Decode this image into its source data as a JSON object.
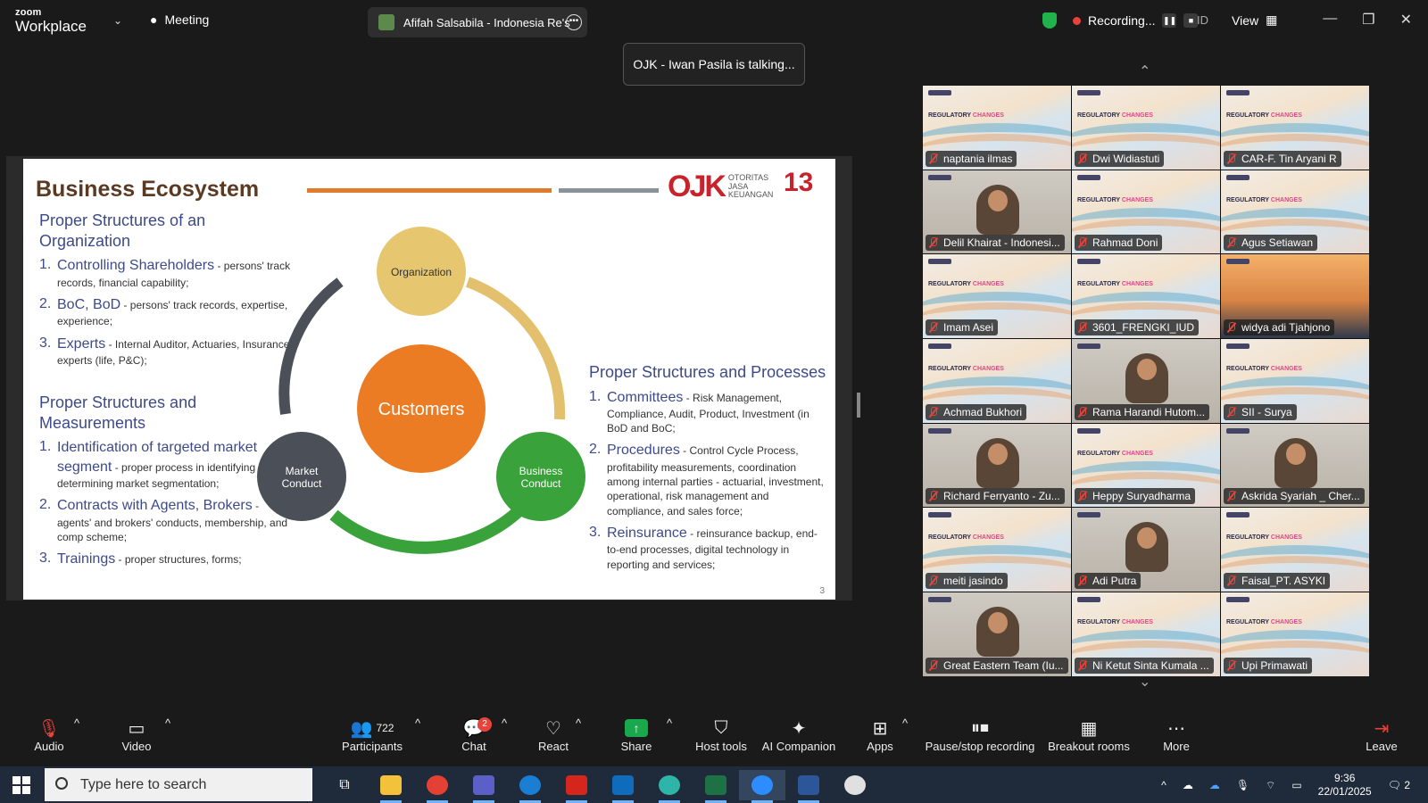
{
  "app": {
    "brand_small": "zoom",
    "brand_big": "Workplace",
    "meeting_label": "Meeting"
  },
  "speaker_pill": {
    "name": "Afifah Salsabila - Indonesia Re's"
  },
  "recording": {
    "label": "Recording...",
    "id_label": "ID",
    "view_label": "View"
  },
  "talking_banner": "OJK - Iwan Pasila is talking...",
  "slide": {
    "title": "Business Ecosystem",
    "logo_mark": "OJK",
    "logo_text_1": "OTORITAS",
    "logo_text_2": "JASA",
    "logo_text_3": "KEUANGAN",
    "anniversary": "13",
    "left_sections": [
      {
        "heading": "Proper Structures of an Organization",
        "items": [
          {
            "num": "1.",
            "lead": "Controlling Shareholders",
            "desc": " - persons' track records, financial capability;"
          },
          {
            "num": "2.",
            "lead": "BoC, BoD",
            "desc": " - persons' track records, expertise, experience;"
          },
          {
            "num": "3.",
            "lead": "Experts",
            "desc": " - Internal Auditor, Actuaries, Insurance experts (life, P&C);"
          }
        ]
      },
      {
        "heading": "Proper Structures and Measurements",
        "items": [
          {
            "num": "1.",
            "lead": "Identification of targeted market segment",
            "desc": " - proper process in identifying and determining market segmentation;"
          },
          {
            "num": "2.",
            "lead": "Contracts with Agents, Brokers",
            "desc": " - agents' and brokers' conducts, membership, and comp scheme;"
          },
          {
            "num": "3.",
            "lead": "Trainings",
            "desc": " - proper structures, forms;"
          }
        ]
      }
    ],
    "right_section": {
      "heading": "Proper Structures and Processes",
      "items": [
        {
          "num": "1.",
          "lead": "Committees",
          "desc": " - Risk Management, Compliance, Audit, Product, Investment (in BoD and BoC;"
        },
        {
          "num": "2.",
          "lead": "Procedures",
          "desc": " - Control Cycle Process, profitability measurements, coordination among internal parties - actuarial, investment, operational, risk management and compliance, and sales force;"
        },
        {
          "num": "3.",
          "lead": "Reinsurance",
          "desc": " - reinsurance backup, end-to-end processes, digital technology in reporting and services;"
        }
      ]
    },
    "diagram": {
      "center": "Customers",
      "top": "Organization",
      "left": "Market Conduct",
      "right": "Business Conduct"
    },
    "page_number": "3"
  },
  "gallery": [
    {
      "name": "naptania ilmas",
      "kind": "slide"
    },
    {
      "name": "Dwi Widiastuti",
      "kind": "slide"
    },
    {
      "name": "CAR-F. Tin Aryani R",
      "kind": "slide"
    },
    {
      "name": "Delil Khairat - Indonesi...",
      "kind": "cam"
    },
    {
      "name": "Rahmad Doni",
      "kind": "slide"
    },
    {
      "name": "Agus Setiawan",
      "kind": "slide"
    },
    {
      "name": "Imam Asei",
      "kind": "slide"
    },
    {
      "name": "3601_FRENGKI_IUD",
      "kind": "slide"
    },
    {
      "name": "widya adi Tjahjono",
      "kind": "bridge"
    },
    {
      "name": "Achmad Bukhori",
      "kind": "slide"
    },
    {
      "name": "Rama Harandi Hutom...",
      "kind": "cam"
    },
    {
      "name": "SII - Surya",
      "kind": "slide"
    },
    {
      "name": "Richard Ferryanto - Zu...",
      "kind": "cam"
    },
    {
      "name": "Heppy Suryadharma",
      "kind": "slide"
    },
    {
      "name": "Askrida Syariah _ Cher...",
      "kind": "cam"
    },
    {
      "name": "meiti jasindo",
      "kind": "slide"
    },
    {
      "name": "Adi Putra",
      "kind": "cam"
    },
    {
      "name": "Faisal_PT. ASYKI",
      "kind": "slide"
    },
    {
      "name": "Great Eastern Team (Iu...",
      "kind": "cam"
    },
    {
      "name": "Ni Ketut Sinta Kumala ...",
      "kind": "slide"
    },
    {
      "name": "Upi Primawati",
      "kind": "slide"
    }
  ],
  "gallery_slide_title_a": "REGULATORY ",
  "gallery_slide_title_b": "CHANGES",
  "toolbar": {
    "audio": "Audio",
    "video": "Video",
    "participants": "Participants",
    "participants_count": "722",
    "chat": "Chat",
    "chat_badge": "2",
    "react": "React",
    "share": "Share",
    "host_tools": "Host tools",
    "ai_companion": "AI Companion",
    "apps": "Apps",
    "pause_recording": "Pause/stop recording",
    "breakout_rooms": "Breakout rooms",
    "more": "More",
    "leave": "Leave"
  },
  "taskbar": {
    "search_placeholder": "Type here to search",
    "time": "9:36",
    "date": "22/01/2025",
    "notif_count": "2"
  },
  "colors": {
    "accent_green": "#19a84b",
    "recording_red": "#e8433a",
    "slide_orange": "#e07a2c",
    "slide_blue": "#3d4a8a",
    "ojk_red": "#c8232c"
  }
}
